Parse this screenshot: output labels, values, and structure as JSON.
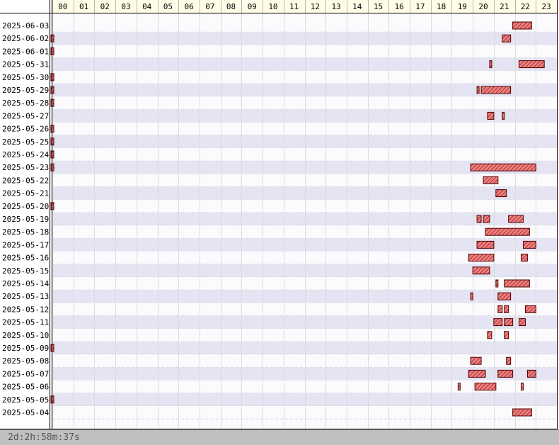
{
  "chart_data": {
    "type": "gantt",
    "x_ticks": [
      "00",
      "01",
      "02",
      "03",
      "04",
      "05",
      "06",
      "07",
      "08",
      "09",
      "10",
      "11",
      "12",
      "13",
      "14",
      "15",
      "16",
      "17",
      "18",
      "19",
      "20",
      "21",
      "22",
      "23"
    ],
    "xlim": [
      0,
      24
    ],
    "rows": [
      {
        "date": "2025-06-03",
        "segments": [
          [
            21.9,
            22.8
          ]
        ]
      },
      {
        "date": "2025-06-02",
        "segments": [
          [
            0.0,
            0.1
          ],
          [
            21.4,
            21.8
          ]
        ]
      },
      {
        "date": "2025-06-01",
        "segments": [
          [
            0.0,
            0.1
          ]
        ]
      },
      {
        "date": "2025-05-31",
        "segments": [
          [
            20.8,
            20.9
          ],
          [
            22.2,
            23.4
          ]
        ]
      },
      {
        "date": "2025-05-30",
        "segments": [
          [
            0.0,
            0.1
          ]
        ]
      },
      {
        "date": "2025-05-29",
        "segments": [
          [
            0.0,
            0.1
          ],
          [
            20.2,
            20.3
          ],
          [
            20.4,
            21.8
          ]
        ]
      },
      {
        "date": "2025-05-28",
        "segments": [
          [
            0.0,
            0.1
          ]
        ]
      },
      {
        "date": "2025-05-27",
        "segments": [
          [
            20.7,
            21.0
          ],
          [
            21.4,
            21.5
          ]
        ]
      },
      {
        "date": "2025-05-26",
        "segments": [
          [
            0.0,
            0.1
          ]
        ]
      },
      {
        "date": "2025-05-25",
        "segments": [
          [
            0.0,
            0.1
          ]
        ]
      },
      {
        "date": "2025-05-24",
        "segments": [
          [
            0.0,
            0.1
          ]
        ]
      },
      {
        "date": "2025-05-23",
        "segments": [
          [
            0.0,
            0.1
          ],
          [
            19.9,
            23.0
          ]
        ]
      },
      {
        "date": "2025-05-22",
        "segments": [
          [
            20.5,
            21.2
          ]
        ]
      },
      {
        "date": "2025-05-21",
        "segments": [
          [
            21.1,
            21.6
          ]
        ]
      },
      {
        "date": "2025-05-20",
        "segments": [
          [
            0.0,
            0.1
          ]
        ]
      },
      {
        "date": "2025-05-19",
        "segments": [
          [
            20.2,
            20.4
          ],
          [
            20.5,
            20.8
          ],
          [
            21.7,
            22.4
          ]
        ]
      },
      {
        "date": "2025-05-18",
        "segments": [
          [
            20.6,
            22.7
          ]
        ]
      },
      {
        "date": "2025-05-17",
        "segments": [
          [
            20.2,
            21.0
          ],
          [
            22.4,
            23.0
          ]
        ]
      },
      {
        "date": "2025-05-16",
        "segments": [
          [
            19.8,
            21.0
          ],
          [
            22.3,
            22.6
          ]
        ]
      },
      {
        "date": "2025-05-15",
        "segments": [
          [
            20.0,
            20.8
          ]
        ]
      },
      {
        "date": "2025-05-14",
        "segments": [
          [
            21.1,
            21.2
          ],
          [
            21.5,
            22.7
          ]
        ]
      },
      {
        "date": "2025-05-13",
        "segments": [
          [
            19.9,
            20.0
          ],
          [
            21.2,
            21.8
          ]
        ]
      },
      {
        "date": "2025-05-12",
        "segments": [
          [
            21.2,
            21.4
          ],
          [
            21.5,
            21.7
          ],
          [
            22.5,
            23.0
          ]
        ]
      },
      {
        "date": "2025-05-11",
        "segments": [
          [
            21.0,
            21.4
          ],
          [
            21.5,
            21.9
          ],
          [
            22.2,
            22.5
          ]
        ]
      },
      {
        "date": "2025-05-10",
        "segments": [
          [
            20.7,
            20.9
          ],
          [
            21.5,
            21.7
          ]
        ]
      },
      {
        "date": "2025-05-09",
        "segments": [
          [
            0.0,
            0.1
          ]
        ]
      },
      {
        "date": "2025-05-08",
        "segments": [
          [
            19.9,
            20.4
          ],
          [
            21.6,
            21.8
          ]
        ]
      },
      {
        "date": "2025-05-07",
        "segments": [
          [
            19.8,
            20.6
          ],
          [
            21.2,
            21.9
          ],
          [
            22.6,
            23.0
          ]
        ]
      },
      {
        "date": "2025-05-06",
        "segments": [
          [
            19.3,
            19.4
          ],
          [
            20.1,
            21.1
          ],
          [
            22.3,
            22.4
          ]
        ]
      },
      {
        "date": "2025-05-05",
        "segments": [
          [
            0.0,
            0.1
          ]
        ]
      },
      {
        "date": "2025-05-04",
        "segments": [
          [
            21.9,
            22.8
          ]
        ]
      }
    ]
  },
  "footer": {
    "uptime": "2d:2h:58m:37s"
  },
  "colors": {
    "bar_fill": "#e06060",
    "bar_stroke": "#500000",
    "row_alt": "#e4e4f2",
    "row_base": "#fbfbfe",
    "header_bg": "#fffde8"
  }
}
